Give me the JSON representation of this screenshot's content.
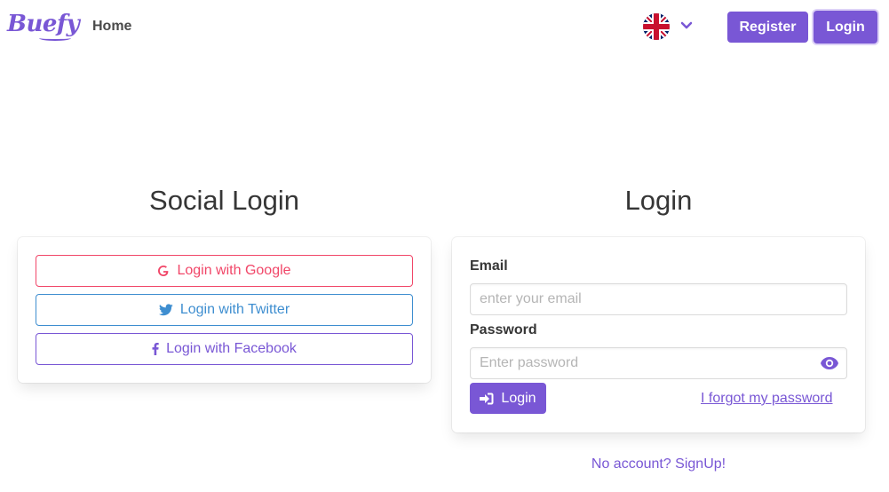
{
  "navbar": {
    "logo_text": "Buefy",
    "home_label": "Home",
    "language": "English (UK)",
    "register_label": "Register",
    "login_label": "Login"
  },
  "social": {
    "title": "Social Login",
    "google_label": "Login with Google",
    "twitter_label": "Login with Twitter",
    "facebook_label": "Login with Facebook"
  },
  "login": {
    "title": "Login",
    "email_label": "Email",
    "email_placeholder": "enter your email",
    "password_label": "Password",
    "password_placeholder": "Enter password",
    "submit_label": "Login",
    "forgot_label": "I forgot my password"
  },
  "signup_link": "No account? SignUp!",
  "colors": {
    "primary": "#7957d5",
    "google": "#f14668",
    "twitter": "#3e8ed0",
    "text": "#363636"
  },
  "icons": [
    "google-icon",
    "twitter-icon",
    "facebook-icon",
    "sign-in-icon",
    "eye-icon",
    "chevron-down-icon",
    "uk-flag-icon"
  ]
}
